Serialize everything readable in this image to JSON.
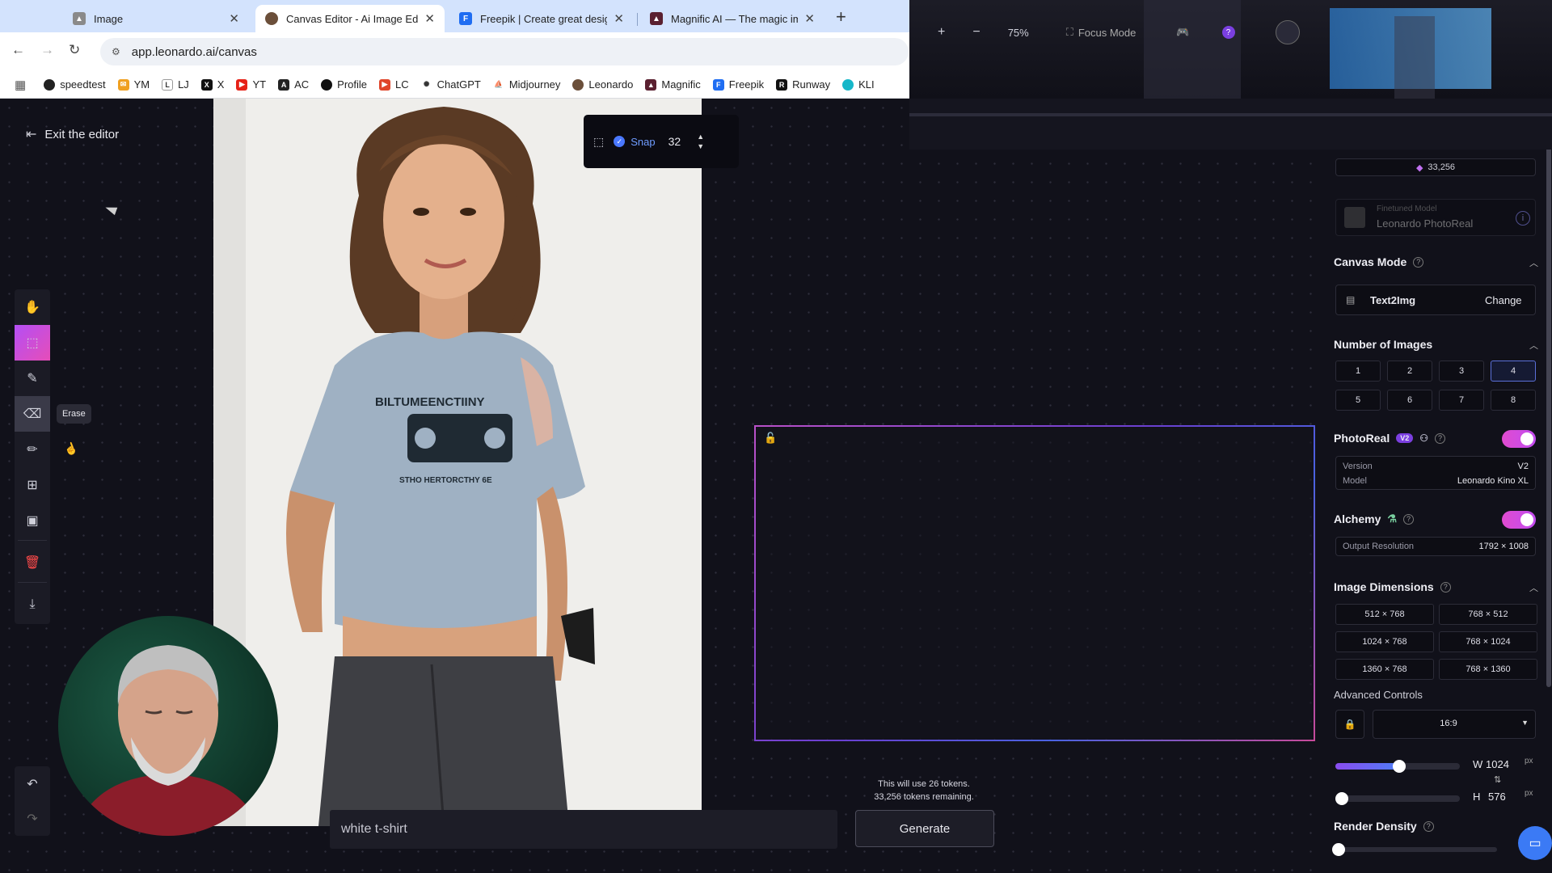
{
  "browser": {
    "tabs": [
      {
        "label": "Image",
        "favicon": "image-favicon",
        "active": false
      },
      {
        "label": "Canvas Editor - Ai Image Editor",
        "favicon": "leonardo-favicon",
        "active": true
      },
      {
        "label": "Freepik | Create great designs",
        "favicon": "freepik-favicon",
        "active": false
      },
      {
        "label": "Magnific AI — The magic image upscaler",
        "favicon": "magnific-favicon",
        "active": false
      }
    ],
    "url": "app.leonardo.ai/canvas",
    "bookmarks": [
      "speedtest",
      "YM",
      "LJ",
      "X",
      "YT",
      "AC",
      "Profile",
      "LC",
      "ChatGPT",
      "Midjourney",
      "Leonardo",
      "Magnific",
      "Freepik",
      "Runway",
      "KLI"
    ]
  },
  "editor": {
    "exit_label": "Exit the editor",
    "tooltip": "Erase",
    "snap_label": "Snap",
    "snap_value": "32",
    "zoom": "75%",
    "focus_mode": "Focus Mode",
    "prompt": "white t-shirt",
    "generate_label": "Generate",
    "tokens_use": "This will use 26 tokens.",
    "tokens_remaining": "33,256 tokens remaining.",
    "shirt_text_1": "BILTUMEENCTIINY",
    "shirt_text_2": "STHO HERTORCTHY 6E"
  },
  "panel": {
    "token_count": "33,256",
    "model_caption": "Finetuned Model",
    "model_name": "Leonardo PhotoReal",
    "canvas_mode_title": "Canvas Mode",
    "canvas_mode_value": "Text2Img",
    "change_label": "Change",
    "num_images_title": "Number of Images",
    "num_images": [
      "1",
      "2",
      "3",
      "4",
      "5",
      "6",
      "7",
      "8"
    ],
    "num_images_selected": "4",
    "photoreal_title": "PhotoReal",
    "photoreal_badge": "V2",
    "photoreal_on": true,
    "version_key": "Version",
    "version_value": "V2",
    "model_key": "Model",
    "model_value": "Leonardo Kino XL",
    "alchemy_title": "Alchemy",
    "alchemy_on": true,
    "output_res_key": "Output Resolution",
    "output_res_value": "1792 × 1008",
    "dims_title": "Image Dimensions",
    "dims": [
      "512 × 768",
      "768 × 512",
      "1024 × 768",
      "768 × 1024",
      "1360 × 768",
      "768 × 1360"
    ],
    "advanced_label": "Advanced Controls",
    "aspect": "16:9",
    "w_label": "W",
    "w_value": "1024",
    "h_label": "H",
    "h_value": "576",
    "unit": "px",
    "render_density_title": "Render Density"
  }
}
